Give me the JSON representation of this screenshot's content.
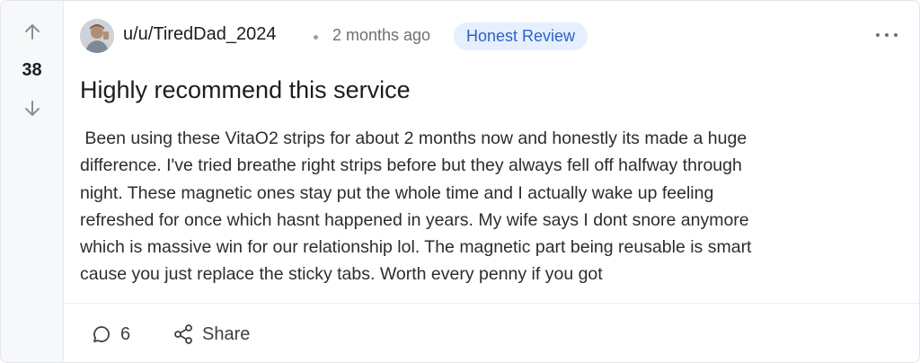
{
  "post": {
    "score": "38",
    "author": "u/u/TiredDad_2024",
    "time": "2 months ago",
    "flair": "Honest Review",
    "title": "Highly recommend this service",
    "body": " Been using these VitaO2 strips for about 2 months now and honestly its made a huge\ndifference. I've tried breathe right strips before but they always fell off halfway through\nnight. These magnetic ones stay put the whole time and I actually wake up feeling\nrefreshed for once which hasnt happened in years. My wife says I dont snore anymore\nwhich is massive win for our relationship lol. The magnetic part being reusable is smart\ncause you just replace the sticky tabs. Worth every penny if you got"
  },
  "actions": {
    "comment_count": "6",
    "share_label": "Share"
  },
  "icons": {
    "upvote": "arrow-up-icon",
    "downvote": "arrow-down-icon",
    "comment": "comment-bubble-icon",
    "share": "share-icon",
    "more": "more-horizontal-icon"
  },
  "colors": {
    "flair_bg": "#e6effd",
    "flair_text": "#2b63c6",
    "vote_column_bg": "#f7f8f9"
  }
}
